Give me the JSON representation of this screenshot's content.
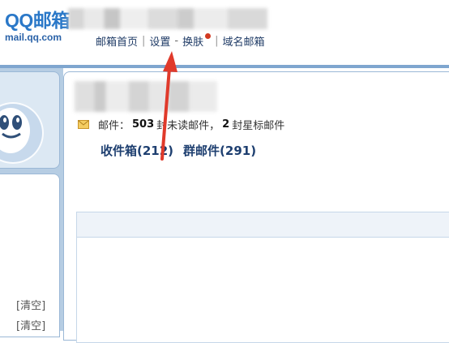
{
  "header": {
    "logo_main": "QQ邮箱",
    "logo_sub": "mail.qq.com",
    "nav": {
      "home": "邮箱首页",
      "settings": "设置",
      "dash": "-",
      "skin": "换肤",
      "domain": "域名邮箱",
      "separator": "|"
    }
  },
  "summary": {
    "prefix": "邮件：",
    "unread_count": "503",
    "unread_text": "封未读邮件，",
    "starred_count": "2",
    "starred_text": "封星标邮件"
  },
  "folders": {
    "inbox": "收件箱(212)",
    "group": "群邮件(291)"
  },
  "sidebar": {
    "clear_labels": [
      "[清空]",
      "[清空]"
    ]
  },
  "colors": {
    "accent_blue": "#2a78c8",
    "header_line": "#7fa6cf",
    "annotation_red": "#e03a2b",
    "notify_dot": "#d23a22"
  }
}
